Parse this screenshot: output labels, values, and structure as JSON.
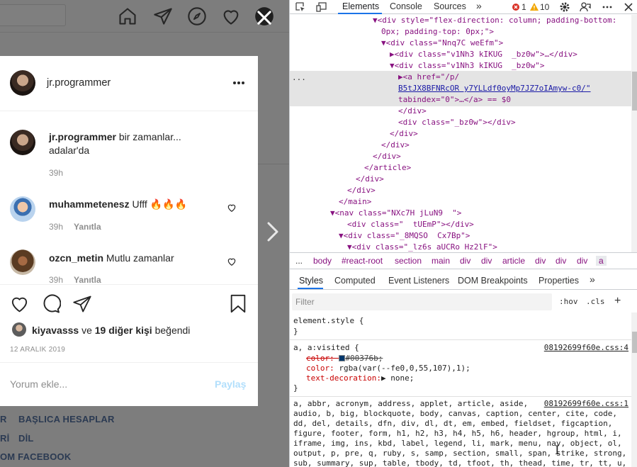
{
  "instagram": {
    "post": {
      "author": "jr.programmer",
      "more_icon": "more-dots-icon",
      "caption_user": "jr.programmer",
      "caption_text": "bir zamanlar...",
      "caption_line2": "adalar'da",
      "caption_time": "39h",
      "comments": [
        {
          "user": "muhammetenesz",
          "text": "Ufff 🔥🔥🔥",
          "time": "39h",
          "reply": "Yanıtla"
        },
        {
          "user": "ozcn_metin",
          "text": "Mutlu zamanlar",
          "time": "39h",
          "reply": "Yanıtla"
        }
      ],
      "likes_user": "kiyavasss",
      "likes_and": "ve",
      "likes_others": "19 diğer kişi",
      "likes_suffix": "beğendi",
      "date": "12 ARALIK 2019",
      "comment_placeholder": "Yorum ekle...",
      "share_label": "Paylaş"
    },
    "footer": [
      {
        "left": "R",
        "right": "BAŞLICA HESAPLAR"
      },
      {
        "left": "Rİ",
        "right": "DİL"
      },
      {
        "left": "OM FACEBOOK",
        "right": ""
      }
    ]
  },
  "devtools": {
    "tabs": [
      "Elements",
      "Console",
      "Sources"
    ],
    "more_tabs": "»",
    "errors": "1",
    "warnings": "10",
    "dom_lines": [
      {
        "t": "▼<div style=\"flex-direction: column; padding-bottom:"
      },
      {
        "t": "0px; padding-top: 0px;\">"
      },
      {
        "t": "▼<div class=\"Nnq7C weEfm\">"
      },
      {
        "t": "▶<div class=\"v1Nh3 kIKUG  _bz0w\">…</div>"
      },
      {
        "t": "▼<div class=\"v1Nh3 kIKUG  _bz0w\">"
      },
      {
        "t": "▶<a href=\"/p/"
      },
      {
        "t": "B5tJX8BFNRcOR y7YLLdf0oyMp7JZ7oIAmyw-c0/\""
      },
      {
        "t": "tabindex=\"0\">…</a> == $0"
      },
      {
        "t": "</div>"
      },
      {
        "t": "<div class=\"_bz0w\"></div>"
      },
      {
        "t": "</div>"
      },
      {
        "t": "</div>"
      },
      {
        "t": "</div>"
      },
      {
        "t": "</article>"
      },
      {
        "t": "</div>"
      },
      {
        "t": "</div>"
      },
      {
        "t": "</main>"
      },
      {
        "t": "▼<nav class=\"NXc7H jLuN9  \">"
      },
      {
        "t": "<div class=\"  tUEmP\"></div>"
      },
      {
        "t": "▼<div class=\"_8MQSO  Cx7Bp\">"
      },
      {
        "t": "▼<div class=\"_lz6s aUCRo Hz2lF\">"
      }
    ],
    "breadcrumbs": [
      "...",
      "body",
      "#react-root",
      "section",
      "main",
      "div",
      "div",
      "article",
      "div",
      "div",
      "div",
      "a"
    ],
    "subtabs": [
      "Styles",
      "Computed",
      "Event Listeners",
      "DOM Breakpoints",
      "Properties",
      "»"
    ],
    "filter_placeholder": "Filter",
    "hov": ":hov",
    "cls": ".cls",
    "plus": "+",
    "rules": {
      "element_style": "element.style {",
      "close": "}",
      "r2_selector": "a, a:visited {",
      "r2_source": "08192699f60e.css:4",
      "r2_color_old": "color: ",
      "r2_color_old_val": "#00376b;",
      "r2_color": "color: ",
      "r2_color_val": "rgba(var(--fe0,0,55,107),1);",
      "r2_td": "text-decoration:",
      "r2_td_val": "▶ none;",
      "r3_source": "08192699f60e.css:1",
      "r3_lines": [
        "a, abbr, acronym, address, applet, article, aside,",
        "audio, b, big, blockquote, body, canvas, caption, center, cite, code,",
        "dd, del, details, dfn, div, dl, dt, em, embed, fieldset, figcaption,",
        "figure, footer, form, h1, h2, h3, h4, h5, h6, header, hgroup, html, i,",
        "iframe, img, ins, kbd, label, legend, li, mark, menu, nav, object, ol,",
        "output, p, pre, q, ruby, s, samp, section, small, span, strike, strong,",
        "sub, summary, sup, table, tbody, td, tfoot, th, thead, time, tr, tt, u,"
      ]
    },
    "cursor_glyph": "I"
  }
}
